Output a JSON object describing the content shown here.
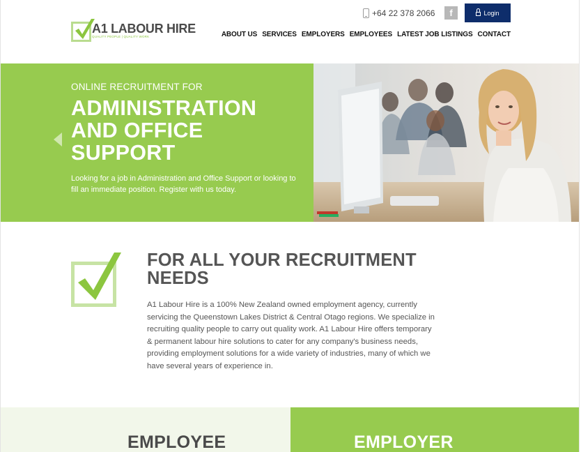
{
  "brand": {
    "name": "A1 LABOUR HIRE",
    "tagline": "QUALITY PEOPLE | QUALITY WORK",
    "accent": "#97cb4f",
    "navy": "#0e2d6b"
  },
  "topbar": {
    "phone": "+64 22 378 2066",
    "facebook": "f",
    "login": "Login"
  },
  "nav": {
    "items": [
      "ABOUT US",
      "SERVICES",
      "EMPLOYERS",
      "EMPLOYEES",
      "LATEST JOB LISTINGS",
      "CONTACT"
    ]
  },
  "hero": {
    "kicker": "ONLINE RECRUITMENT FOR",
    "title": "ADMINISTRATION AND OFFICE SUPPORT",
    "description": "Looking for a job in Administration and Office Support or looking to fill an immediate position. Register with us today."
  },
  "intro": {
    "title": "FOR ALL YOUR RECRUITMENT NEEDS",
    "body": "A1 Labour Hire is a 100% New Zealand owned employment agency, currently servicing the Queenstown Lakes District & Central Otago regions. We specialize in recruiting quality people to carry out quality work. A1 Labour Hire offers temporary & permanent labour hire solutions to cater for any company's business needs, providing employment solutions for a wide variety of industries, many of which we have several years of experience in."
  },
  "panels": {
    "left_title": "EMPLOYEE",
    "right_title": "EMPLOYER"
  }
}
